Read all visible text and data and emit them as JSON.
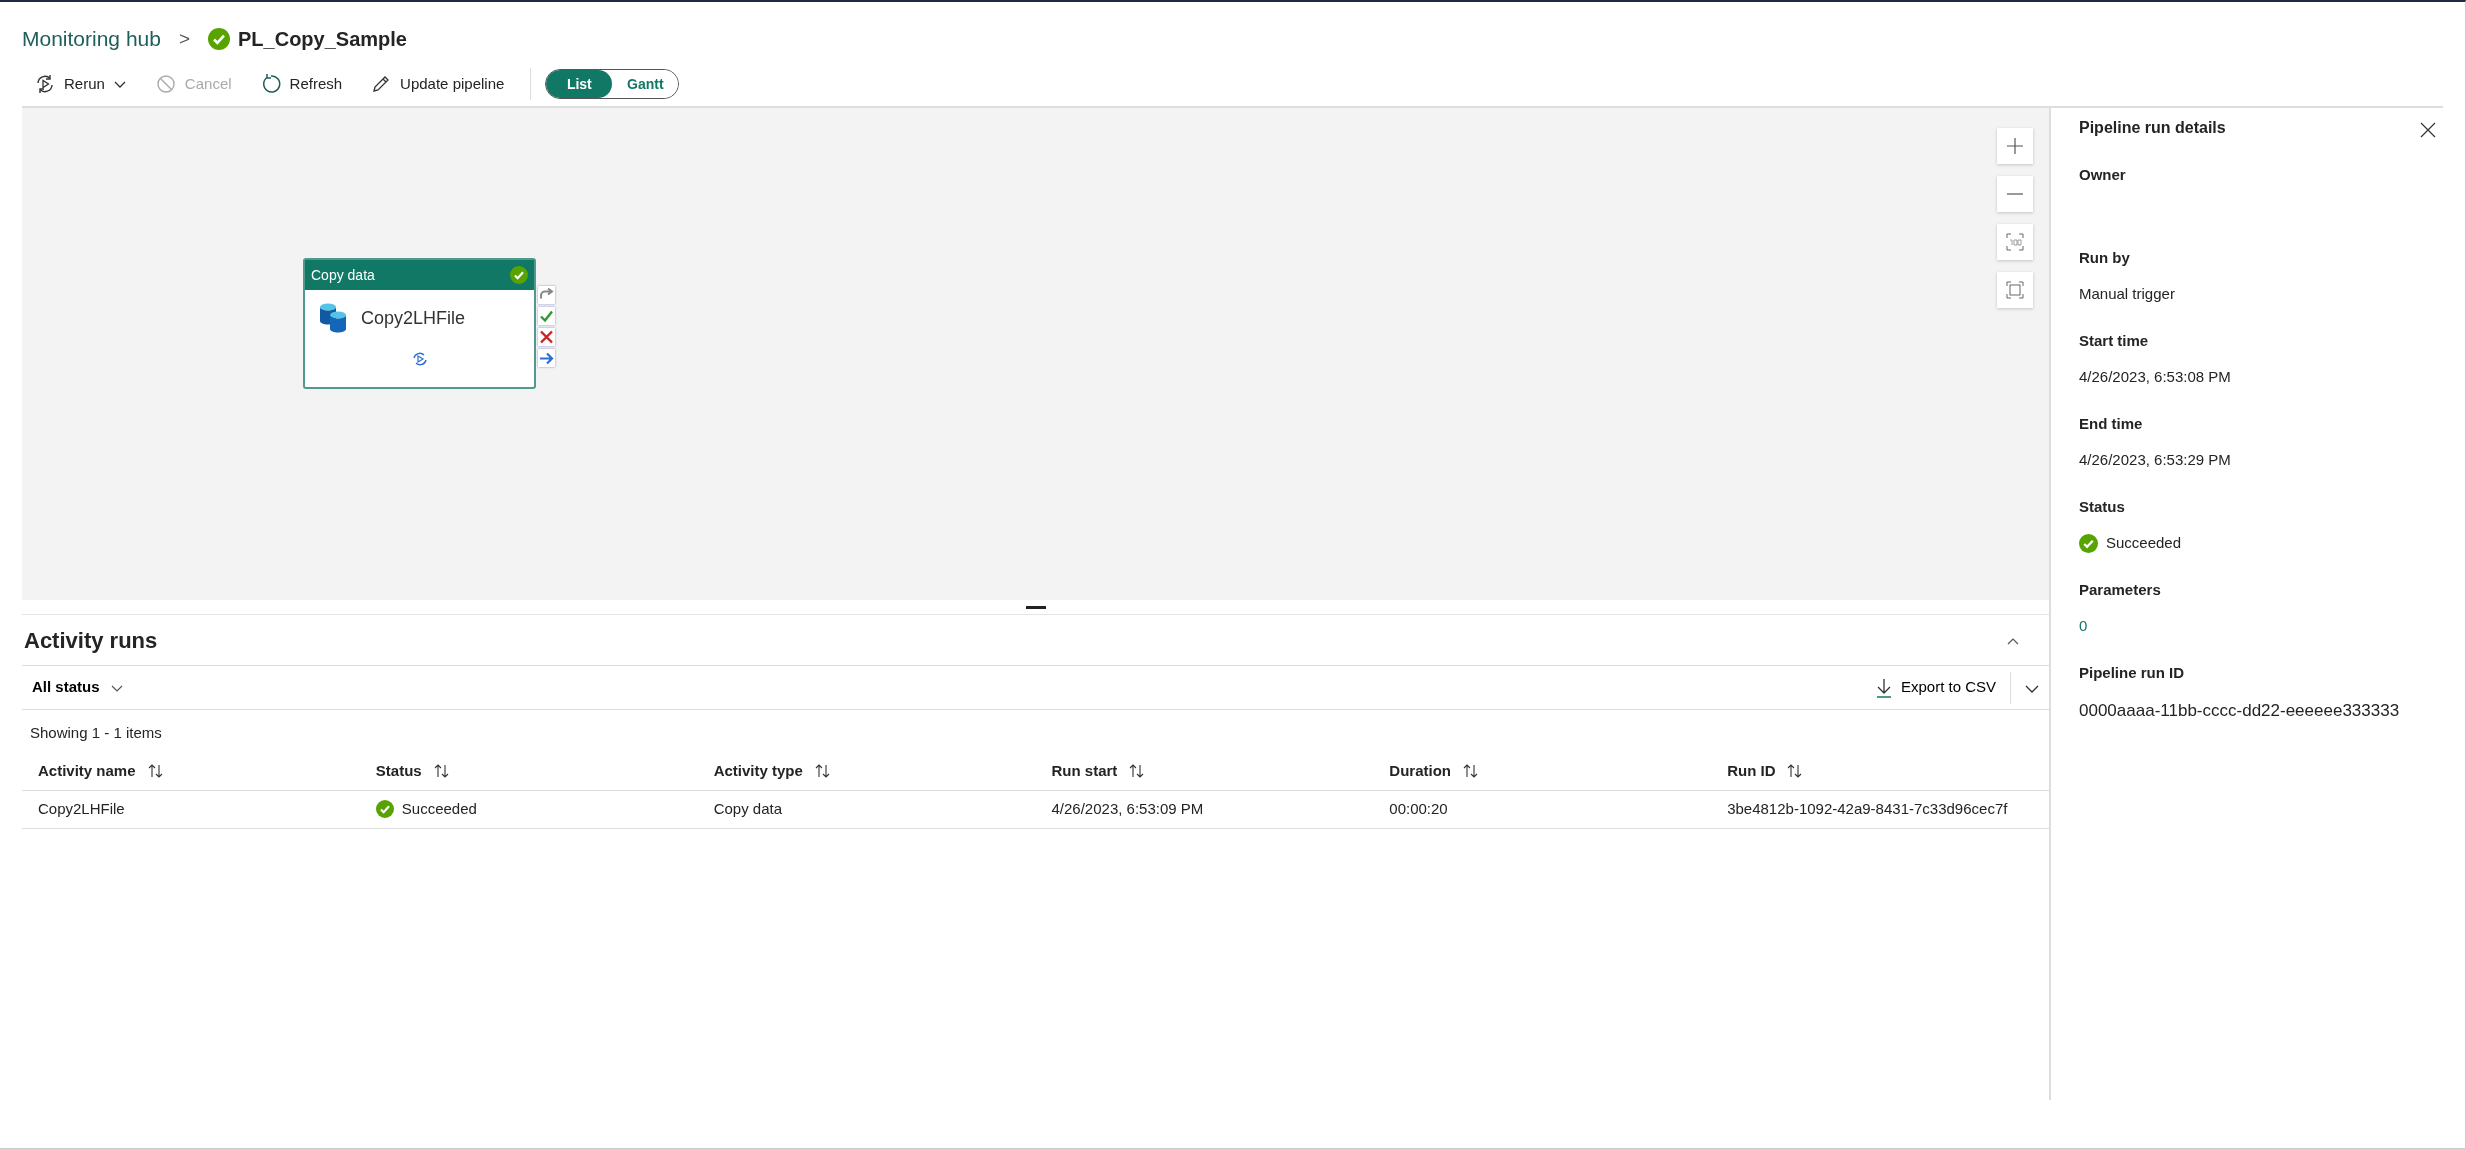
{
  "breadcrumb": {
    "parent": "Monitoring hub",
    "separator": ">",
    "current": "PL_Copy_Sample",
    "succeeded": true
  },
  "toolbar": [
    {
      "kind": "rerun",
      "label": "Rerun",
      "disabled": false,
      "has_menu": true
    },
    {
      "kind": "cancel",
      "label": "Cancel",
      "disabled": true,
      "has_menu": false
    },
    {
      "kind": "refresh",
      "label": "Refresh",
      "disabled": false,
      "has_menu": false
    },
    {
      "kind": "edit",
      "label": "Update pipeline",
      "disabled": false,
      "has_menu": false
    }
  ],
  "view_toggle": [
    {
      "label": "List",
      "selected": true
    },
    {
      "label": "Gantt",
      "selected": false
    }
  ],
  "canvas": {
    "activity": {
      "type": "Copy data",
      "name": "Copy2LHFile",
      "succeeded": true
    }
  },
  "activity_runs": {
    "title": "Activity runs",
    "filter": "All status",
    "export": "Export to CSV",
    "count": "Showing 1 - 1 items",
    "columns": [
      {
        "label": "Activity name",
        "kind": "text"
      },
      {
        "label": "Status",
        "kind": "status"
      },
      {
        "label": "Activity type",
        "kind": "text"
      },
      {
        "label": "Run start",
        "kind": "text"
      },
      {
        "label": "Duration",
        "kind": "text"
      },
      {
        "label": "Run ID",
        "kind": "text"
      }
    ],
    "rows": [
      {
        "succeeded": true,
        "cells": [
          "Copy2LHFile",
          "Succeeded",
          "Copy data",
          "4/26/2023, 6:53:09 PM",
          "00:00:20",
          "3be4812b-1092-42a9-8431-7c33d96cec7f"
        ]
      }
    ]
  },
  "details": {
    "title": "Pipeline run details",
    "fields": [
      {
        "label": "Owner"
      },
      {
        "label": "Run by",
        "kind": "text",
        "value": "Manual trigger"
      },
      {
        "label": "Start time",
        "kind": "text",
        "value": "4/26/2023, 6:53:08 PM"
      },
      {
        "label": "End time",
        "kind": "text",
        "value": "4/26/2023, 6:53:29 PM"
      },
      {
        "label": "Status",
        "kind": "status",
        "succeeded": true,
        "value": "Succeeded"
      },
      {
        "label": "Parameters",
        "kind": "link",
        "value": "0"
      },
      {
        "label": "Pipeline run ID",
        "kind": "text",
        "value": "0000aaaa-11bb-cccc-dd22-eeeeee333333"
      }
    ]
  }
}
